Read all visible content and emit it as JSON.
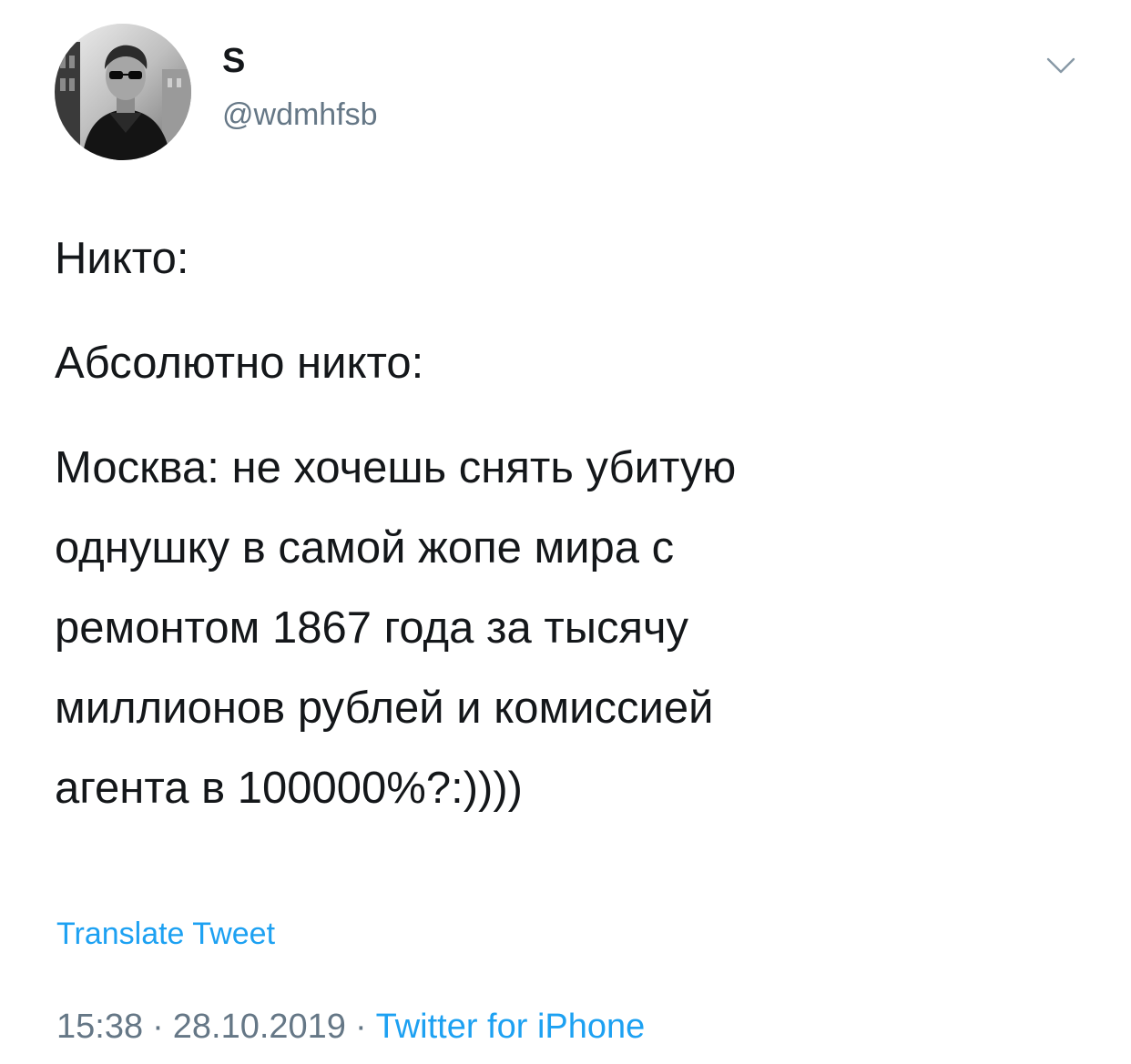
{
  "user": {
    "display_name": "S",
    "handle": "@wdmhfsb",
    "avatar_icon": "user-photo"
  },
  "menu_icon": "chevron-down-icon",
  "tweet": {
    "paragraphs": [
      "Никто:",
      "Абсолютно никто:",
      "Москва: не хочешь снять убитую\nоднушку в самой жопе мира с\nремонтом 1867 года за тысячу\nмиллионов рублей и комиссией\nагента в 100000%?:))))"
    ]
  },
  "translate_label": "Translate Tweet",
  "meta": {
    "time": "15:38",
    "separator": "·",
    "date": "28.10.2019",
    "source": "Twitter for iPhone"
  },
  "colors": {
    "text": "#14171a",
    "secondary": "#657786",
    "link": "#1da1f2"
  }
}
